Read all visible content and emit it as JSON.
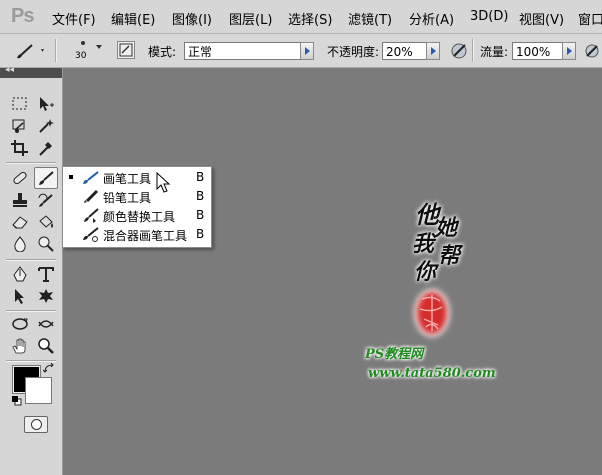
{
  "app": {
    "logo": "Ps"
  },
  "menu": [
    "文件(F)",
    "编辑(E)",
    "图像(I)",
    "图层(L)",
    "选择(S)",
    "滤镜(T)",
    "分析(A)",
    "3D(D)",
    "视图(V)",
    "窗口"
  ],
  "options": {
    "brush_size": "30",
    "mode_label": "模式:",
    "mode_value": "正常",
    "opacity_label": "不透明度:",
    "opacity_value": "20%",
    "flow_label": "流量:",
    "flow_value": "100%"
  },
  "toolbox": {
    "collapse_glyph": "◂◂"
  },
  "flyout": {
    "items": [
      {
        "label": "画笔工具",
        "key": "B",
        "selected": true,
        "icon": "brush-icon"
      },
      {
        "label": "铅笔工具",
        "key": "B",
        "selected": false,
        "icon": "pencil-icon"
      },
      {
        "label": "颜色替换工具",
        "key": "B",
        "selected": false,
        "icon": "color-replace-icon"
      },
      {
        "label": "混合器画笔工具",
        "key": "B",
        "selected": false,
        "icon": "mixer-brush-icon"
      }
    ]
  },
  "canvas": {
    "calligraphy": [
      "他",
      "她",
      "我",
      "帮",
      "你"
    ],
    "seal_text": "PS教程网",
    "url_text": "www.tata580.com"
  },
  "colors": {
    "canvas": "#7b7b7b",
    "seal": "#d42020",
    "watermark": "#1f8a1f"
  }
}
